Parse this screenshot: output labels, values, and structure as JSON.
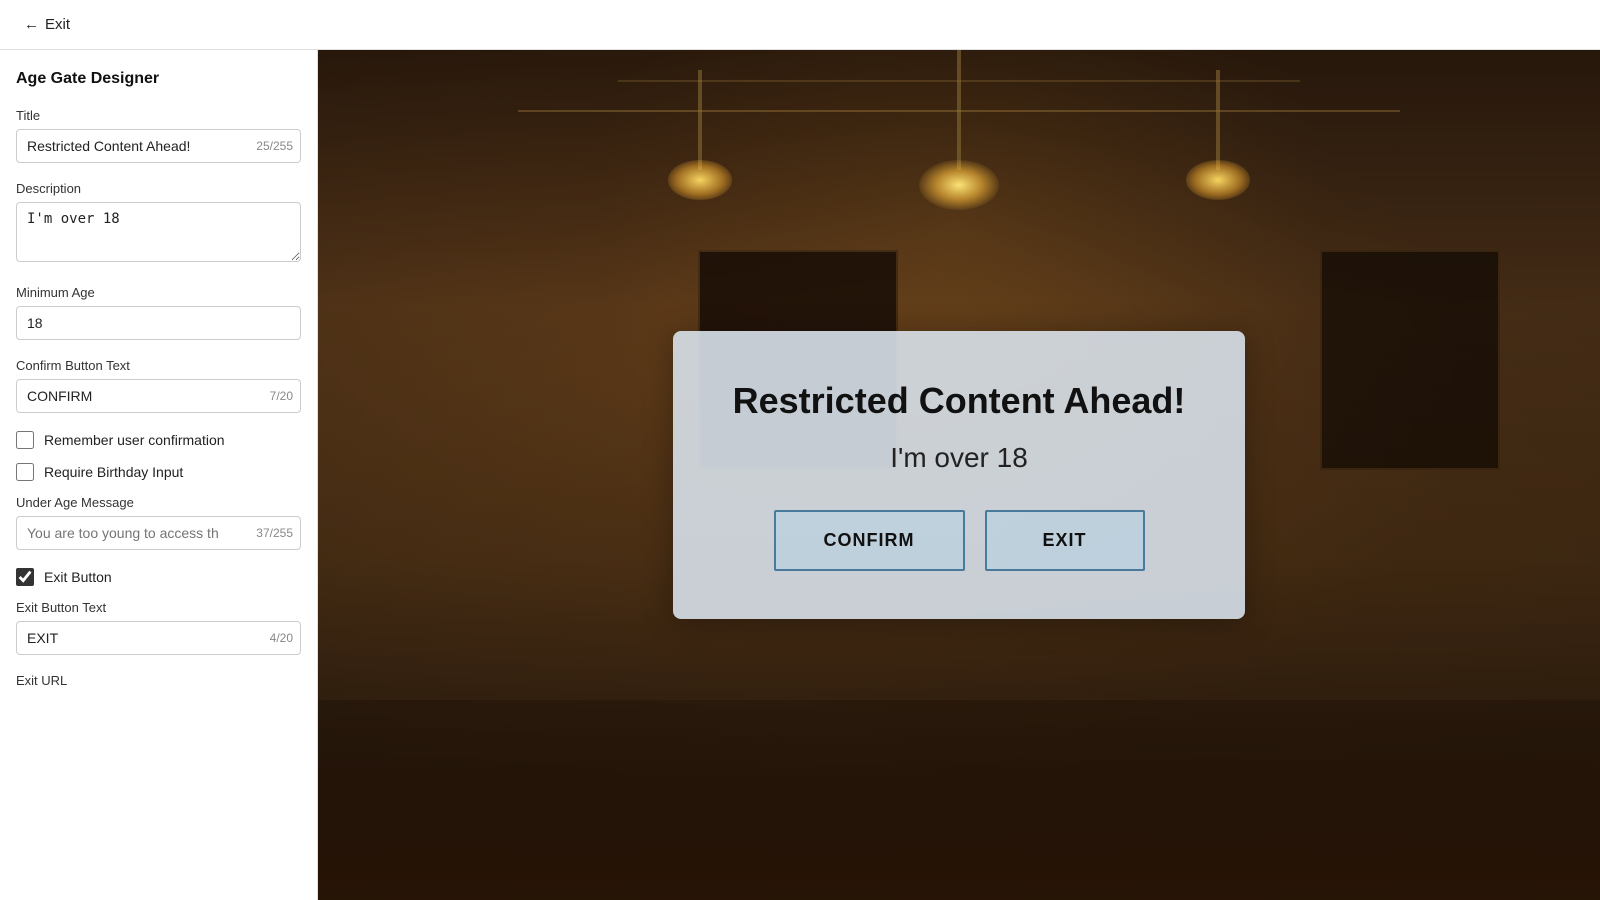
{
  "topbar": {
    "exit_label": "Exit"
  },
  "sidebar": {
    "title": "Age Gate Designer",
    "fields": {
      "title_label": "Title",
      "title_value": "Restricted Content Ahead!",
      "title_char_count": "25/255",
      "description_label": "Description",
      "description_value": "I'm over 18",
      "min_age_label": "Minimum Age",
      "min_age_value": "18",
      "confirm_button_text_label": "Confirm Button Text",
      "confirm_button_text_value": "CONFIRM",
      "confirm_button_char_count": "7/20",
      "remember_user_label": "Remember user confirmation",
      "require_birthday_label": "Require Birthday Input",
      "under_age_label": "Under Age Message",
      "under_age_placeholder": "You are too young to access th",
      "under_age_char_count": "37/255",
      "exit_button_label": "Exit Button",
      "exit_button_text_label": "Exit Button Text",
      "exit_button_text_value": "EXIT",
      "exit_button_char_count": "4/20",
      "exit_url_label": "Exit URL"
    }
  },
  "modal": {
    "title": "Restricted Content Ahead!",
    "description": "I'm over 18",
    "confirm_button": "CONFIRM",
    "exit_button": "EXIT"
  }
}
